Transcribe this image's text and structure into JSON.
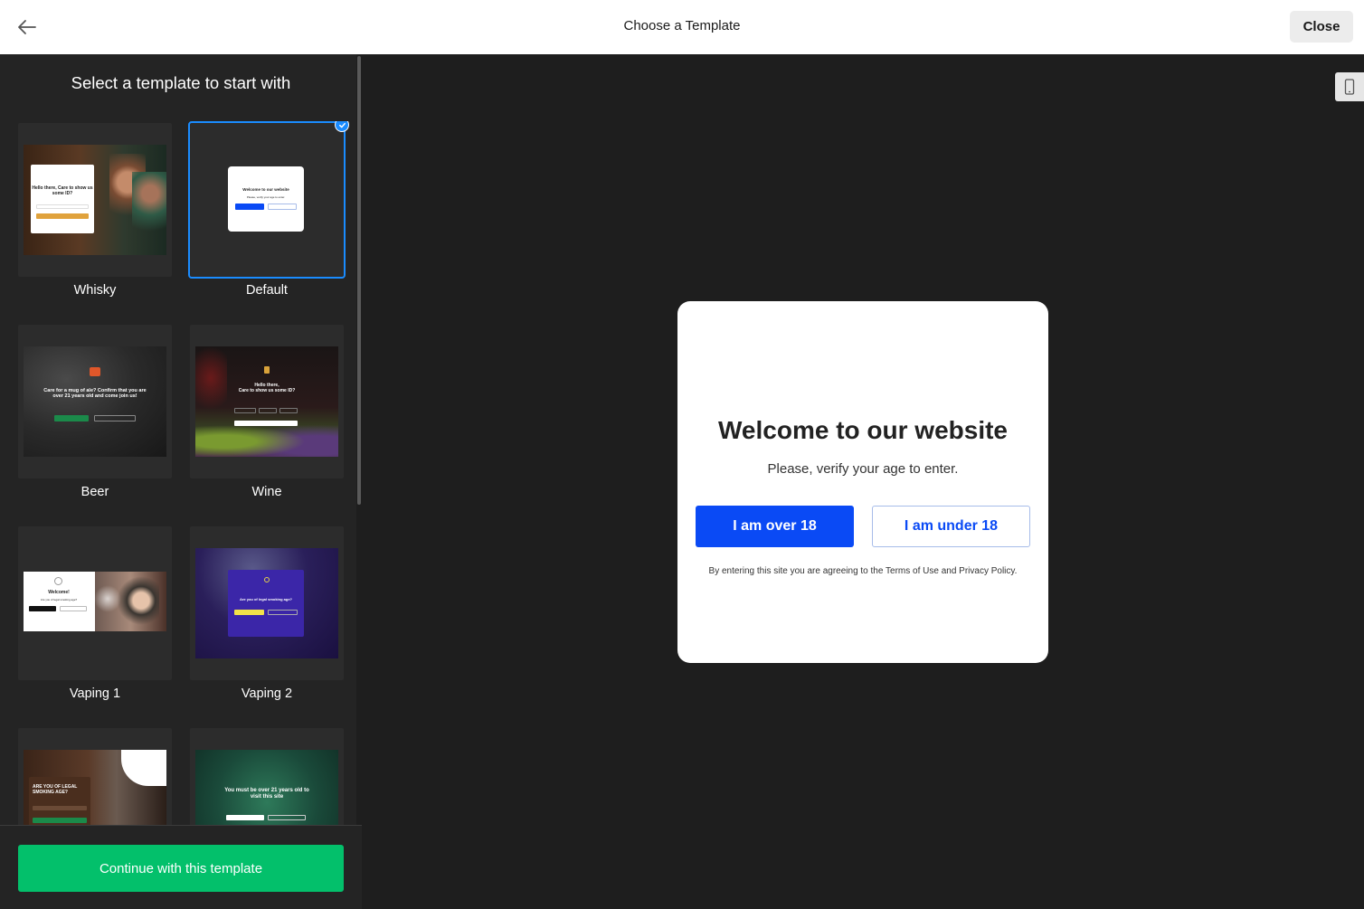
{
  "header": {
    "title": "Choose a Template",
    "close_label": "Close"
  },
  "sidebar": {
    "heading": "Select a template to start with",
    "templates": [
      {
        "name": "Whisky",
        "selected": false
      },
      {
        "name": "Default",
        "selected": true
      },
      {
        "name": "Beer",
        "selected": false
      },
      {
        "name": "Wine",
        "selected": false
      },
      {
        "name": "Vaping 1",
        "selected": false
      },
      {
        "name": "Vaping 2",
        "selected": false
      },
      {
        "name": "",
        "selected": false
      },
      {
        "name": "",
        "selected": false
      }
    ],
    "continue_label": "Continue with this template"
  },
  "preview": {
    "modal": {
      "title": "Welcome to our website",
      "subtitle": "Please, verify your age to enter.",
      "over_label": "I am over 18",
      "under_label": "I am under 18",
      "legal": "By entering this site you are agreeing to the Terms of Use and Privacy Policy."
    }
  },
  "thumbnails": {
    "whisky": {
      "title": "Hello there,\nCare to show us some ID?",
      "button": "Enter"
    },
    "default": {
      "title": "Welcome to our website",
      "sub": "Please, verify your age to enter.",
      "btn1": "I am over 18",
      "btn2": "I am under 18"
    },
    "beer": {
      "title": "Care for a mug of ale? Confirm that you are over 21 years old and come join us!",
      "btn1": "I AM OVER 21 YEARS",
      "btn2": "I AM UNDER 21 YEARS"
    },
    "wine": {
      "title": "Hello there,\nCare to show us some ID?",
      "button": "Enter"
    },
    "vaping1": {
      "title": "Welcome!",
      "sub": "Are you of legal smoking age?",
      "btn1": "Yes",
      "btn2": "No"
    },
    "vaping2": {
      "title": "Are you of legal smoking age?",
      "btn1": "Yes",
      "btn2": "No"
    },
    "smoking": {
      "title": "ARE YOU OF LEGAL SMOKING AGE?"
    },
    "cannabis": {
      "title": "You must be over 21 years old to visit this site"
    }
  },
  "colors": {
    "accent_green": "#03c06b",
    "selection_blue": "#1a8cff",
    "primary_blue": "#0a4af5",
    "sidebar_bg": "#242424",
    "preview_bg": "#1e1e1e"
  }
}
